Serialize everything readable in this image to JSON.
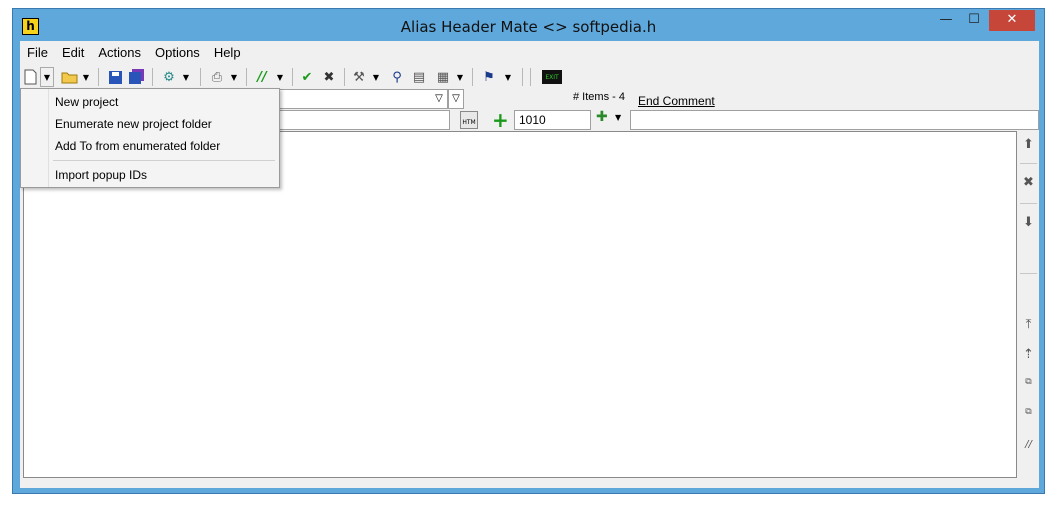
{
  "window": {
    "title": "Alias Header Mate <> softpedia.h",
    "app_icon_letter": "h",
    "controls": {
      "minimize": "—",
      "maximize": "☐",
      "close": "✕"
    }
  },
  "menubar": [
    "File",
    "Edit",
    "Actions",
    "Options",
    "Help"
  ],
  "toolbar": {
    "icons": [
      "new-file-icon",
      "open-folder-icon",
      "save-icon",
      "save-all-icon",
      "generate-icon",
      "print-icon",
      "comment-icon",
      "check-icon",
      "cancel-icon",
      "tools-icon",
      "find-icon",
      "sheet-icon",
      "template-icon",
      "explorer-icon",
      "exit-icon"
    ],
    "exit_label": "EXIT"
  },
  "items": {
    "label": "# Items - 4",
    "value": "1010"
  },
  "end_comment": {
    "label": "End Comment",
    "value": ""
  },
  "popup_menu": {
    "items": [
      "New project",
      "Enumerate new project folder",
      "Add To from enumerated folder",
      "Import popup IDs"
    ]
  },
  "colors": {
    "window_frame": "#5fa8dc",
    "close_button": "#c7463a",
    "client_background": "#f0f0f0",
    "add_icon": "#1a9a1a"
  }
}
